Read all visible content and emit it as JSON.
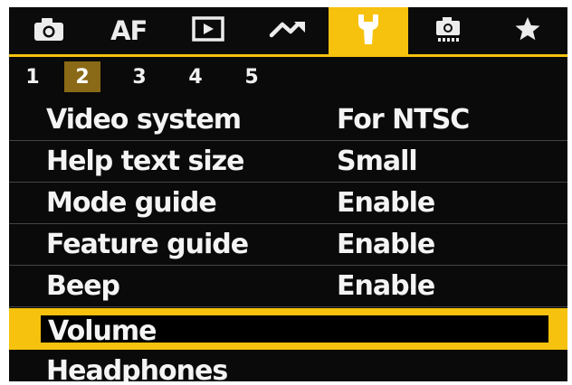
{
  "tabs": [
    {
      "name": "shooting",
      "icon": "camera-icon"
    },
    {
      "name": "af",
      "label": "AF"
    },
    {
      "name": "playback",
      "icon": "play-icon"
    },
    {
      "name": "wireless",
      "icon": "wireless-icon"
    },
    {
      "name": "setup",
      "icon": "wrench-icon",
      "active": true
    },
    {
      "name": "custom",
      "icon": "custom-camera-icon"
    },
    {
      "name": "my-menu",
      "icon": "star-icon"
    }
  ],
  "pages": [
    "1",
    "2",
    "3",
    "4",
    "5"
  ],
  "active_page": "2",
  "menu": [
    {
      "label": "Video system",
      "value": "For NTSC"
    },
    {
      "label": "Help text size",
      "value": "Small"
    },
    {
      "label": "Mode guide",
      "value": "Enable"
    },
    {
      "label": "Feature guide",
      "value": "Enable"
    },
    {
      "label": "Beep",
      "value": "Enable"
    },
    {
      "label": "Volume",
      "value": "",
      "selected": true
    },
    {
      "label": "Headphones",
      "value": ""
    }
  ],
  "colors": {
    "accent": "#f6c20e",
    "background": "#0a0a0a",
    "text": "#f4f4f4",
    "active_page": "#8a6a16"
  }
}
